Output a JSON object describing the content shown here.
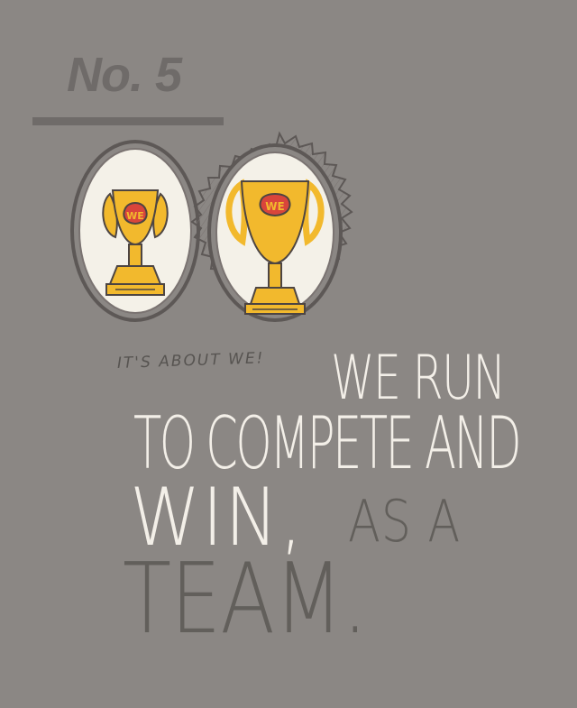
{
  "number_label": "No. 5",
  "trophy_badge_text": "WE",
  "handwritten_note": "IT'S ABOUT WE!",
  "headline": {
    "line1": "WE RUN",
    "line2": "TO COMPETE AND",
    "line3_main": "WIN,",
    "line3_tail": "AS A",
    "line4": "TEAM."
  },
  "colors": {
    "background": "#8b8784",
    "dark_text": "#625f5b",
    "light_text": "#f3efe8",
    "trophy_gold": "#f2b92d",
    "frame_line": "#5d5856",
    "cream": "#f4f1e8"
  }
}
